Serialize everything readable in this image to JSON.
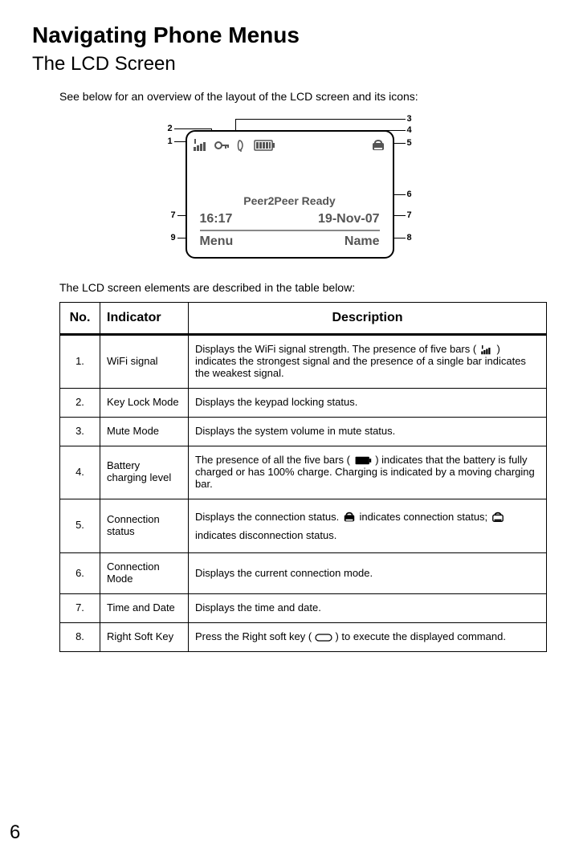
{
  "title": "Navigating Phone Menus",
  "subtitle": "The LCD Screen",
  "intro": "See below for an overview of the layout of the LCD screen and its icons:",
  "lcd": {
    "peer": "Peer2Peer Ready",
    "time": "16:17",
    "date": "19-Nov-07",
    "left_soft": "Menu",
    "right_soft": "Name"
  },
  "callouts": {
    "c1": "1",
    "c2": "2",
    "c3": "3",
    "c4": "4",
    "c5": "5",
    "c6": "6",
    "c7l": "7",
    "c7r": "7",
    "c8": "8",
    "c9": "9"
  },
  "table_intro": "The LCD screen elements are described in the table below:",
  "headers": {
    "no": "No.",
    "ind": "Indicator",
    "desc": "Description"
  },
  "rows": [
    {
      "no": "1.",
      "ind": "WiFi signal",
      "desc_a": "Displays the WiFi signal strength. The presence of five bars (",
      "desc_b": ") indicates the strongest signal and the presence of a single bar indicates the weakest signal."
    },
    {
      "no": "2.",
      "ind": "Key Lock Mode",
      "desc": "Displays the keypad locking status."
    },
    {
      "no": "3.",
      "ind": "Mute Mode",
      "desc": "Displays the system volume in mute status."
    },
    {
      "no": "4.",
      "ind": "Battery charging level",
      "desc_a": "The presence of all the five bars (",
      "desc_b": ") indicates that the battery is fully charged or has 100% charge. Charging is indicated by a moving charging bar."
    },
    {
      "no": "5.",
      "ind": "Connection status",
      "desc_a": "Displays the connection status. ",
      "desc_b": " indicates connection status; ",
      "desc_c": " indicates disconnection status."
    },
    {
      "no": "6.",
      "ind": "Connection Mode",
      "desc": "Displays the current connection mode."
    },
    {
      "no": "7.",
      "ind": "Time and Date",
      "desc": "Displays the time and date."
    },
    {
      "no": "8.",
      "ind": "Right Soft Key",
      "desc_a": "Press the Right soft key (",
      "desc_b": ") to execute the displayed command."
    }
  ],
  "page_number": "6"
}
